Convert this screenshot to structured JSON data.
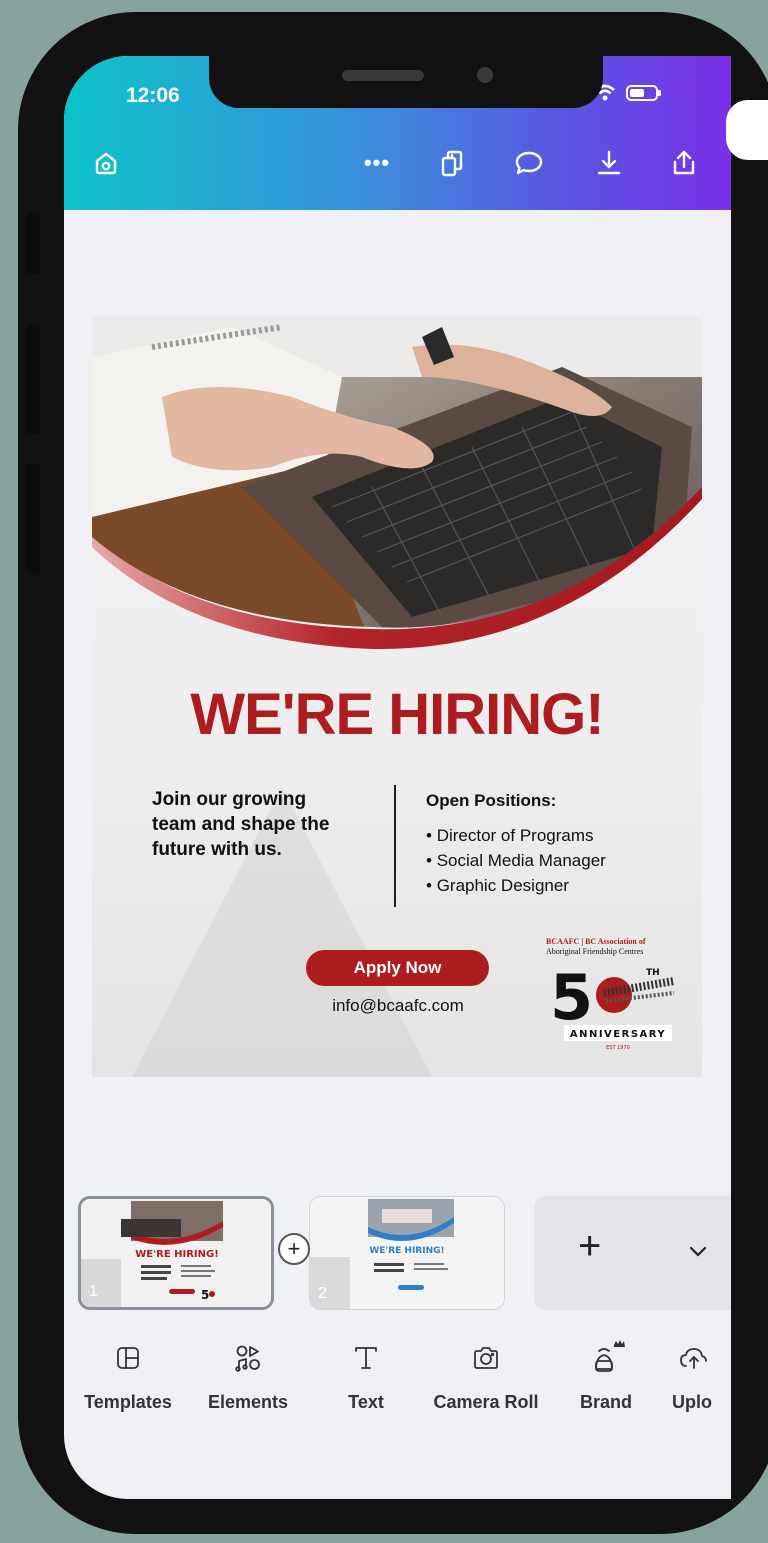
{
  "status_bar": {
    "time": "12:06"
  },
  "top_toolbar": {
    "icons": [
      "home-icon",
      "more-icon",
      "pages-icon",
      "comment-icon",
      "download-icon",
      "share-icon"
    ],
    "more_label": "•••"
  },
  "design": {
    "headline": "WE'RE HIRING!",
    "join_text": "Join our growing team and shape the future with us.",
    "open_positions_title": "Open Positions:",
    "positions": [
      "Director of Programs",
      "Social Media Manager",
      "Graphic Designer"
    ],
    "apply_label": "Apply Now",
    "email": "info@bcaafc.com",
    "logo": {
      "org_line1": "BCAAFC | BC Association of",
      "org_line2": "Aboriginal Friendship Centres",
      "anniversary": "ANNIVERSARY",
      "number": "50",
      "suffix": "TH",
      "est": "EST 1970"
    },
    "colors": {
      "brand_red": "#ad1c1f",
      "accent_blue": "#2f7fc8"
    }
  },
  "pages": {
    "thumbs": [
      {
        "number": "1",
        "headline": "WE'RE HIRING!",
        "selected": true
      },
      {
        "number": "2",
        "headline": "WE'RE HIRING!",
        "selected": false
      }
    ],
    "add_label": "+",
    "insert_label": "+",
    "expand_icon": "chevron-down-icon"
  },
  "bottom_toolbar": {
    "items": [
      {
        "label": "Templates",
        "icon": "templates-icon"
      },
      {
        "label": "Elements",
        "icon": "elements-icon"
      },
      {
        "label": "Text",
        "icon": "text-icon"
      },
      {
        "label": "Camera Roll",
        "icon": "camera-icon"
      },
      {
        "label": "Brand",
        "icon": "brand-icon"
      },
      {
        "label": "Uplo",
        "icon": "upload-icon"
      }
    ]
  }
}
